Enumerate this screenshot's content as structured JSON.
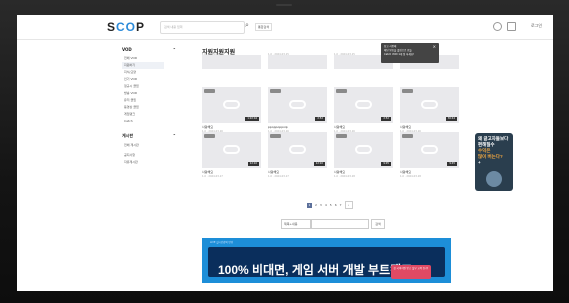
{
  "header": {
    "logo": "SOOP",
    "search_placeholder": "검색 내용 입력",
    "search_tag": "통합검색",
    "login": "로그인"
  },
  "sidebar": {
    "vod_title": "VOD",
    "vod_items": [
      "전체 VOD",
      "지원하기",
      "지식/교양",
      "인기 VOD",
      "정규시 클립",
      "방송 VOD",
      "유저 클립",
      "동영상 클립",
      "게임랭크",
      "Catch"
    ],
    "section2_title": "게시판",
    "section2_items": [
      "전체 게시판",
      "공지사항",
      "자유게시판"
    ]
  },
  "page_title": "지원지원지원",
  "tooltip": {
    "lines": [
      "참고 사항해",
      "채팅 방송을 클립으로 만들",
      "Catch VOD 1개 정 하세요!"
    ]
  },
  "cards": [
    {
      "title": "",
      "meta": "1.0 · 2024-03-15",
      "duration": "",
      "row": 0
    },
    {
      "title": "",
      "meta": "1.0 · 2024-03-15",
      "duration": "",
      "row": 0
    },
    {
      "title": "",
      "meta": "1.0 · 2024-03-15",
      "duration": "",
      "row": 0
    },
    {
      "title": "",
      "meta": "1.0 · 2024-03-15",
      "duration": "",
      "row": 0
    },
    {
      "title": "사랑해요",
      "meta": "1.0 · 2024-03-16",
      "duration": "1:02:44",
      "row": 1
    },
    {
      "title": "ppoppoppoip",
      "meta": "1.0 · 2024-03-16",
      "duration": "2:52",
      "row": 1
    },
    {
      "title": "사랑해요",
      "meta": "1.0 · 2024-03-16",
      "duration": "2:52",
      "row": 1
    },
    {
      "title": "사랑해요",
      "meta": "1.0 · 2024-03-16",
      "duration": "36:44",
      "row": 1
    },
    {
      "title": "사랑해요",
      "meta": "1.0 · 2024-03-17",
      "duration": "12:10",
      "row": 2
    },
    {
      "title": "사랑해요",
      "meta": "1.0 · 2024-03-17",
      "duration": "12:10",
      "row": 2
    },
    {
      "title": "사랑해요",
      "meta": "1.0 · 2024-03-18",
      "duration": "9:05",
      "row": 2
    },
    {
      "title": "사랑해요",
      "meta": "1.0 · 2024-03-18",
      "duration": "9:45",
      "row": 2
    }
  ],
  "pagination": {
    "pages": [
      "1",
      "2",
      "3",
      "4",
      "5",
      "6",
      "7"
    ],
    "current": "1"
  },
  "search_filter": {
    "select": "제목+내용",
    "button": "검색"
  },
  "banner": {
    "label": "LIVE 실시간강의 반영",
    "headline": "100% 비대면, 게임 서버 개발 부트캠프",
    "cta": "첫 국비지원 받고 실무 교육 듣기!"
  },
  "ad": {
    "lines": [
      "왜 글고자들보다",
      "편해질수",
      "수익은",
      "많이 버는다?",
      "+"
    ]
  },
  "colors": {
    "accent": "#1d8ed8",
    "banner_dark": "#0a2e5c",
    "cta": "#e04a64"
  }
}
